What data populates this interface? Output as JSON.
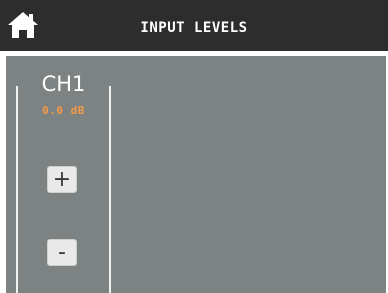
{
  "header": {
    "title": "INPUT LEVELS",
    "home_icon": "home-icon"
  },
  "colors": {
    "header_bg": "#2d2d2d",
    "panel_bg": "#7d8283",
    "level_text": "#f29a45"
  },
  "channels": [
    {
      "label": "CH1",
      "level": "0.0 dB",
      "increase_label": "+",
      "decrease_label": "-"
    }
  ]
}
